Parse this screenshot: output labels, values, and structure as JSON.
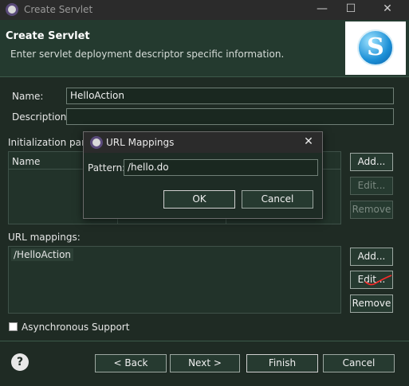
{
  "window": {
    "title": "Create Servlet",
    "minimize_glyph": "—",
    "maximize_glyph": "☐",
    "close_glyph": "✕"
  },
  "header": {
    "title": "Create Servlet",
    "subtitle": "Enter servlet deployment descriptor specific information.",
    "logo_letter": "S"
  },
  "form": {
    "name_label": "Name:",
    "name_value": "HelloAction",
    "description_label": "Description:",
    "description_value": "",
    "init_params_label": "Initialization parameters:",
    "init_params_columns": [
      "Name"
    ],
    "init_buttons": {
      "add": "Add...",
      "edit": "Edit...",
      "remove": "Remove"
    },
    "url_mappings_label": "URL mappings:",
    "url_mappings": [
      "/HelloAction"
    ],
    "url_buttons": {
      "add": "Add...",
      "edit": "Edit...",
      "remove": "Remove"
    },
    "async_label": "Asynchronous Support"
  },
  "dialog": {
    "title": "URL Mappings",
    "close_glyph": "✕",
    "pattern_label": "Pattern:",
    "pattern_value": "/hello.do",
    "ok_label": "OK",
    "cancel_label": "Cancel"
  },
  "footer": {
    "help_glyph": "?",
    "back_label": "< Back",
    "next_label": "Next >",
    "finish_label": "Finish",
    "cancel_label": "Cancel"
  },
  "colors": {
    "background": "#1f2b24",
    "header_bg": "#243a2f",
    "accent_annotation": "#ff2a2a"
  }
}
